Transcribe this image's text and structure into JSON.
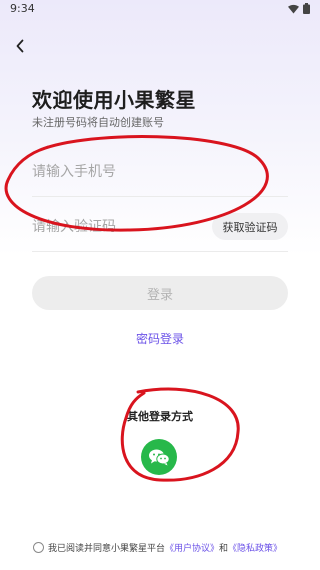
{
  "status_bar": {
    "time": "9:34"
  },
  "header": {
    "title": "欢迎使用小果繁星",
    "subtitle": "未注册号码将自动创建账号"
  },
  "form": {
    "phone_placeholder": "请输入手机号",
    "code_placeholder": "请输入验证码",
    "get_code_label": "获取验证码",
    "login_label": "登录",
    "password_login_label": "密码登录"
  },
  "other_login": {
    "label": "其他登录方式",
    "options": [
      {
        "icon": "wechat-icon",
        "color": "#27B84A"
      }
    ]
  },
  "agreement": {
    "prefix": "我已阅读并同意小果繁星平台",
    "user_agreement": "《用户协议》",
    "and": "和",
    "privacy_policy": "《隐私政策》",
    "checked": false
  },
  "colors": {
    "accent": "#6B52E8",
    "annotation": "#D9141E",
    "wechat": "#27B84A",
    "disabled_button": "#EDEDED"
  }
}
